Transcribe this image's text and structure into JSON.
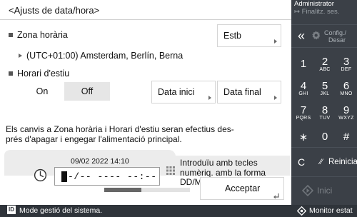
{
  "title": "<Ajusts de data/hora>",
  "timezone": {
    "label": "Zona horària",
    "button": "Estb",
    "value": "(UTC+01:00) Amsterdam, Berlín, Berna"
  },
  "dst": {
    "label": "Horari d'estiu",
    "on": "On",
    "off": "Off",
    "selected": "Off",
    "start_button": "Data inici",
    "end_button": "Data final"
  },
  "notice": "Els canvis a Zona horària i Horari d'estiu seran efectius des-prés d'apagar i engegar l'alimentació principal.",
  "datetime": {
    "current": "09/02 2022 14:10",
    "input_value": "-/-- ---- --:--",
    "hint": "Introduïu amb tecles numèriq. amb la forma DD/MM AAAA hh:mm."
  },
  "progress": 0.43,
  "accept_button": "Acceptar",
  "keypad": {
    "admin_label": "Administrator",
    "logout_label": "Finalitz. ses.",
    "settings_label_1": "Config./",
    "settings_label_2": "Desar",
    "back": "«",
    "keys": [
      {
        "n": "1",
        "s": ""
      },
      {
        "n": "2",
        "s": "ABC"
      },
      {
        "n": "3",
        "s": "DEF"
      },
      {
        "n": "4",
        "s": "GHI"
      },
      {
        "n": "5",
        "s": "JKL"
      },
      {
        "n": "6",
        "s": "MNO"
      },
      {
        "n": "7",
        "s": "PQRS"
      },
      {
        "n": "8",
        "s": "TUV"
      },
      {
        "n": "9",
        "s": "WXYZ"
      },
      {
        "n": "∗",
        "s": ""
      },
      {
        "n": "0",
        "s": ""
      },
      {
        "n": "#",
        "s": ""
      }
    ],
    "clear": "C",
    "reset": "Reiniciar",
    "start": "Inici"
  },
  "status": {
    "left_icon": "ID",
    "left": "Mode gestió del sistema.",
    "right": "Monitor estat"
  },
  "colors": {
    "seg_selected": "#e6e6e6",
    "panel_bg": "#ececec",
    "keypad_bg": "#3b4047",
    "status_bg": "#2f343a"
  }
}
